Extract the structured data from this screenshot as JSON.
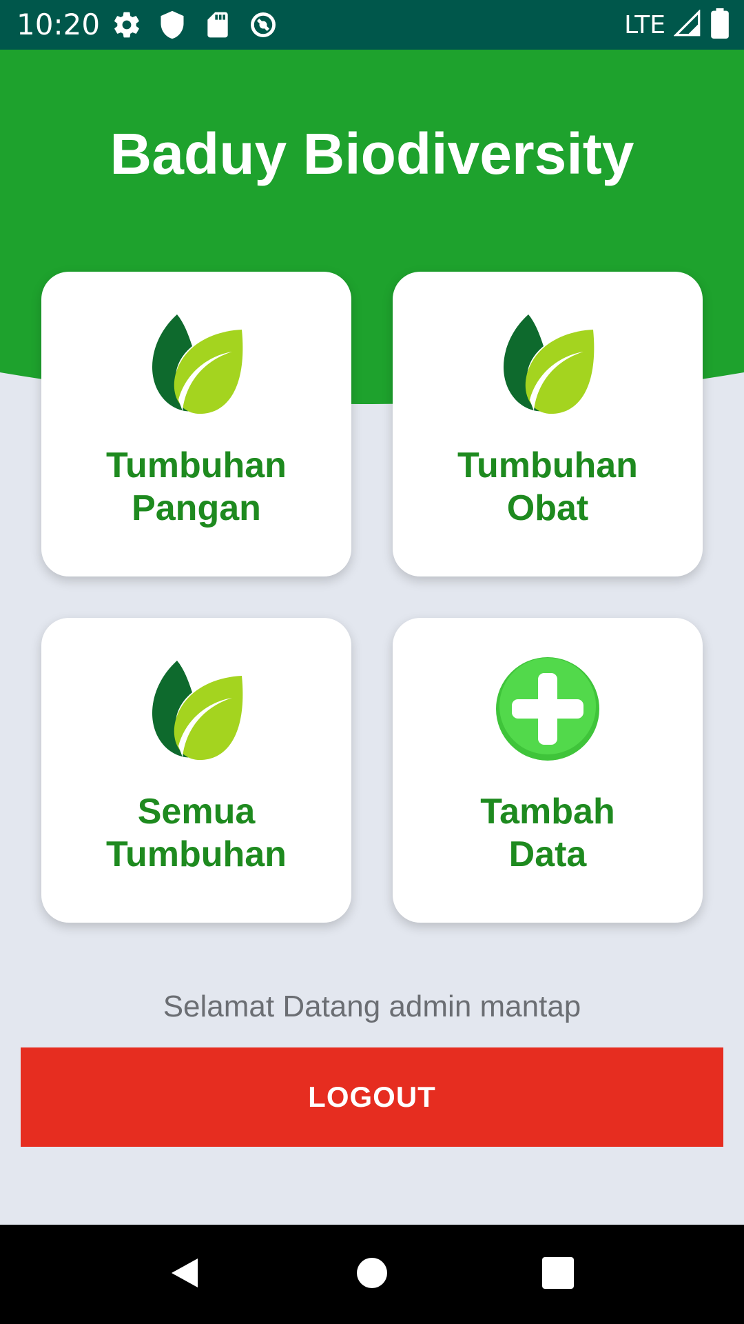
{
  "status_bar": {
    "time": "10:20",
    "network": "LTE",
    "icons": [
      "gear-icon",
      "shield-icon",
      "sd-card-icon",
      "data-saver-icon",
      "signal-icon",
      "battery-icon"
    ]
  },
  "header": {
    "title": "Baduy Biodiversity"
  },
  "menu": {
    "items": [
      {
        "line1": "Tumbuhan",
        "line2": "Pangan",
        "icon": "leaf-icon"
      },
      {
        "line1": "Tumbuhan",
        "line2": "Obat",
        "icon": "leaf-icon"
      },
      {
        "line1": "Semua",
        "line2": "Tumbuhan",
        "icon": "leaf-icon"
      },
      {
        "line1": "Tambah",
        "line2": "Data",
        "icon": "plus-circle-icon"
      }
    ]
  },
  "welcome_text": "Selamat Datang admin mantap",
  "logout_label": "LOGOUT",
  "nav": {
    "icons": [
      "back-icon",
      "home-icon",
      "recents-icon"
    ]
  },
  "colors": {
    "status_bar": "#00574b",
    "header": "#1ea22d",
    "background": "#e3e7ef",
    "card_text": "#1e8a1f",
    "logout": "#e62d20"
  }
}
